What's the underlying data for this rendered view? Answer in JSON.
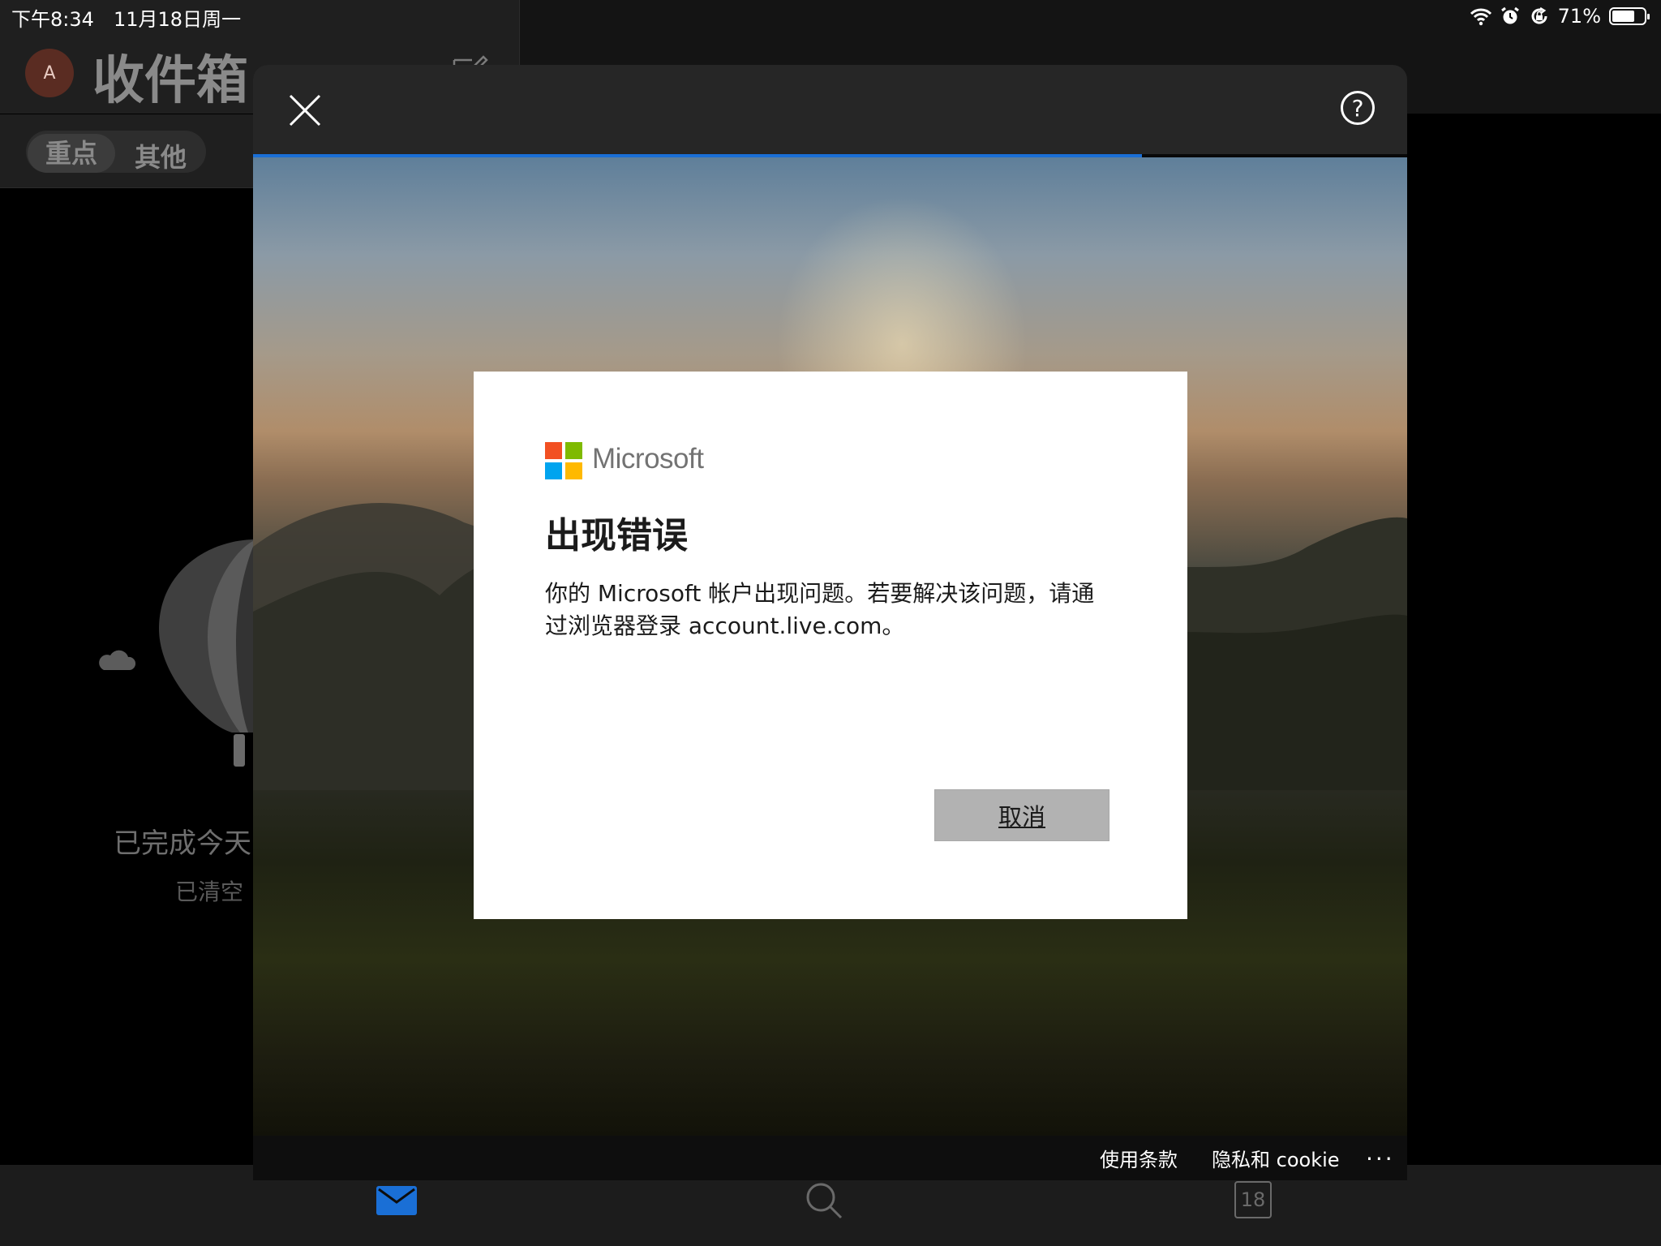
{
  "status_bar": {
    "time": "下午8:34",
    "date": "11月18日周一",
    "battery_text": "71%",
    "battery_level": 0.71,
    "icons": [
      "wifi-icon",
      "alarm-icon",
      "orientation-lock-icon"
    ]
  },
  "mail_app": {
    "avatar_initial": "A",
    "inbox_title": "收件箱",
    "tabs": [
      {
        "label": "重点",
        "selected": true
      },
      {
        "label": "其他",
        "selected": false
      }
    ],
    "empty_state": {
      "title": "已完成今天",
      "subtitle": "已清空"
    },
    "bottom_nav": {
      "mail_icon": "mail-icon",
      "search_icon": "search-icon",
      "calendar_day": "18"
    }
  },
  "signin_sheet": {
    "progress": 0.77,
    "footer": {
      "terms": "使用条款",
      "privacy": "隐私和 cookie",
      "more": "..."
    }
  },
  "error_dialog": {
    "brand": "Microsoft",
    "title": "出现错误",
    "message": "你的 Microsoft 帐户出现问题。若要解决该问题，请通过浏览器登录 account.live.com。",
    "cancel_label": "取消"
  },
  "colors": {
    "progress_blue": "#1a6fd6",
    "ms_red": "#f25022",
    "ms_green": "#7fba00",
    "ms_blue": "#00a4ef",
    "ms_yellow": "#ffb900",
    "nav_active": "#1a6fd6"
  }
}
